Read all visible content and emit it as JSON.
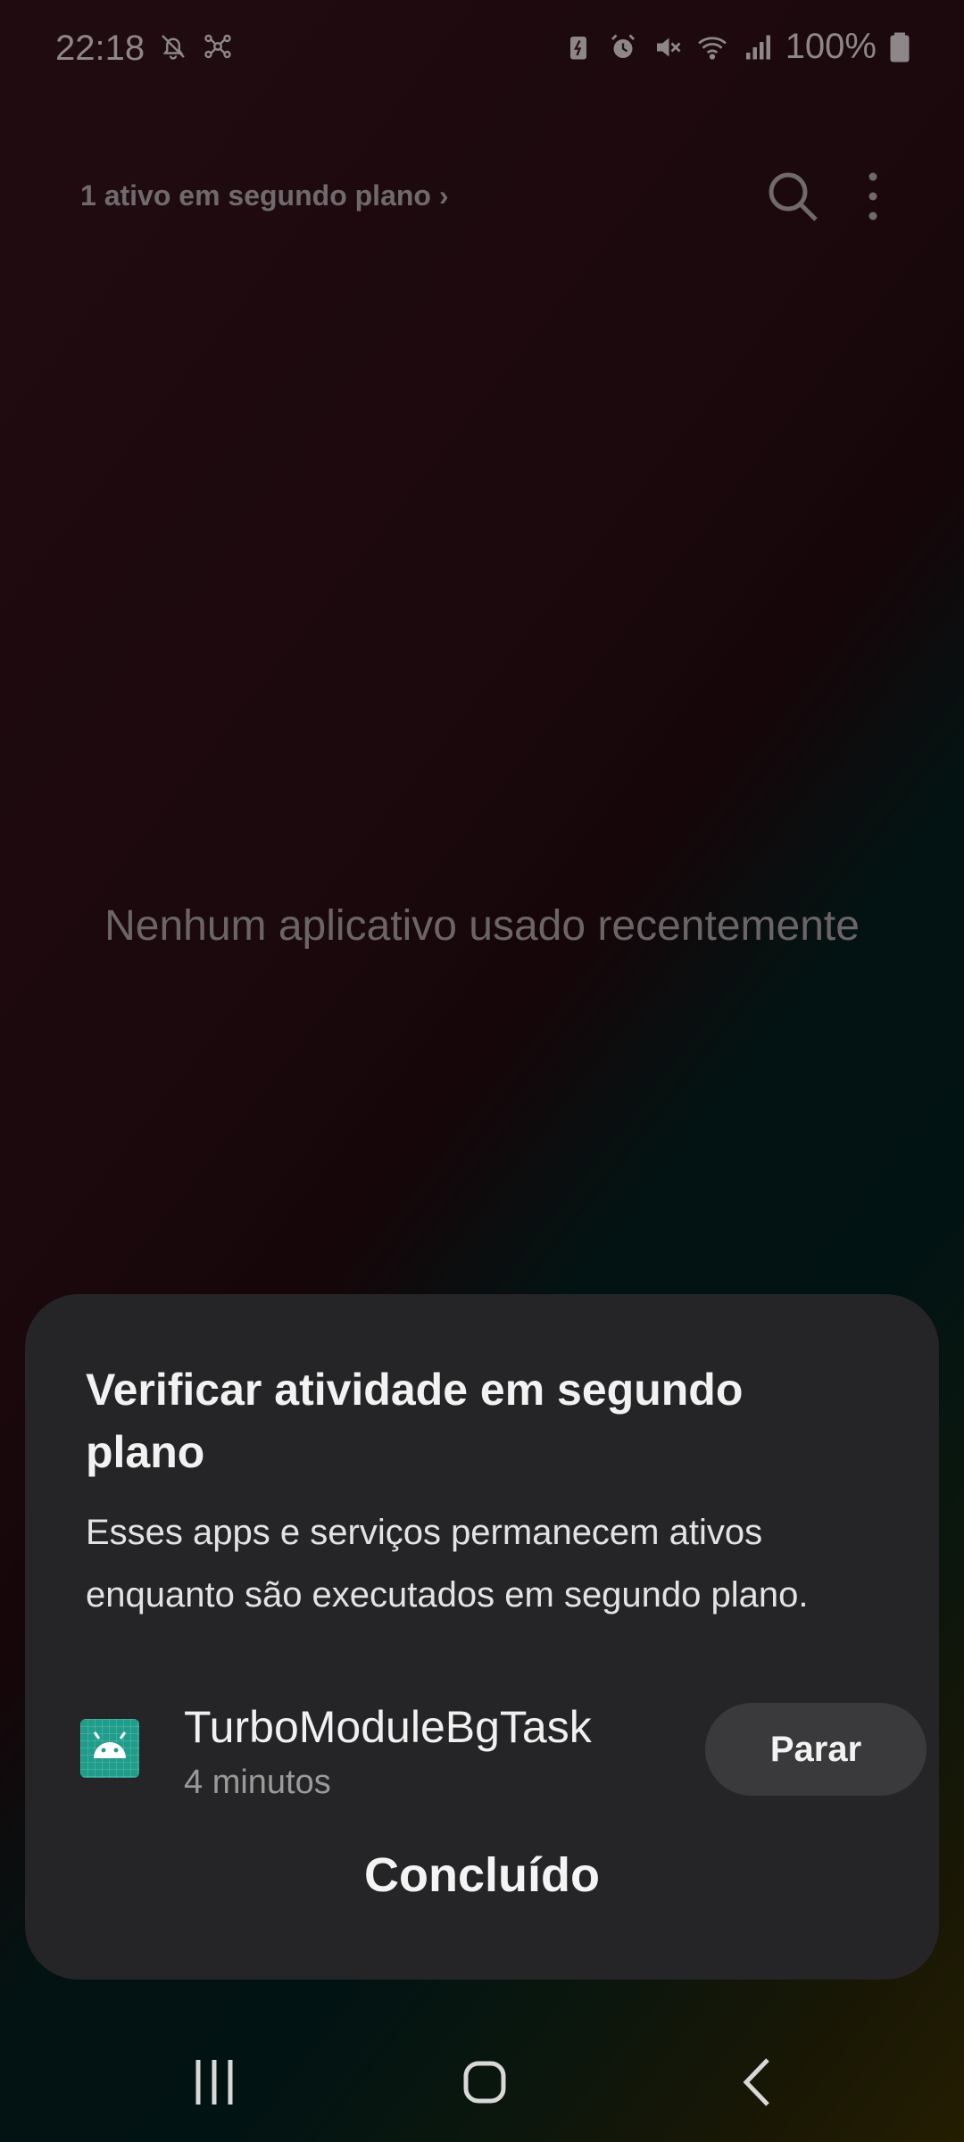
{
  "status_bar": {
    "time": "22:18",
    "left_icons": [
      "bell-muted-icon",
      "network-hub-icon"
    ],
    "right_icons": [
      "battery-saver-icon",
      "alarm-icon",
      "sound-muted-icon",
      "wifi-icon",
      "cell-signal-icon"
    ],
    "battery_percent": "100%"
  },
  "recents": {
    "background_active_label": "1 ativo em segundo plano",
    "search_icon": "search-icon",
    "more_icon": "more-vertical-icon",
    "empty_message": "Nenhum aplicativo usado recentemente"
  },
  "sheet": {
    "title": "Verificar atividade em segundo plano",
    "description": "Esses apps e serviços permanecem ativos enquanto são executados em segundo plano.",
    "apps": [
      {
        "name": "TurboModuleBgTask",
        "duration": "4 minutos",
        "icon": "android-app-icon",
        "stop_label": "Parar"
      }
    ],
    "done_label": "Concluído"
  },
  "navbar": {
    "recents_icon": "recent-apps-icon",
    "home_icon": "home-icon",
    "back_icon": "back-icon"
  },
  "colors": {
    "sheet_bg": "#252527",
    "app_icon_bg": "#1f9c8a",
    "stop_button_bg": "#3a3a3c"
  }
}
